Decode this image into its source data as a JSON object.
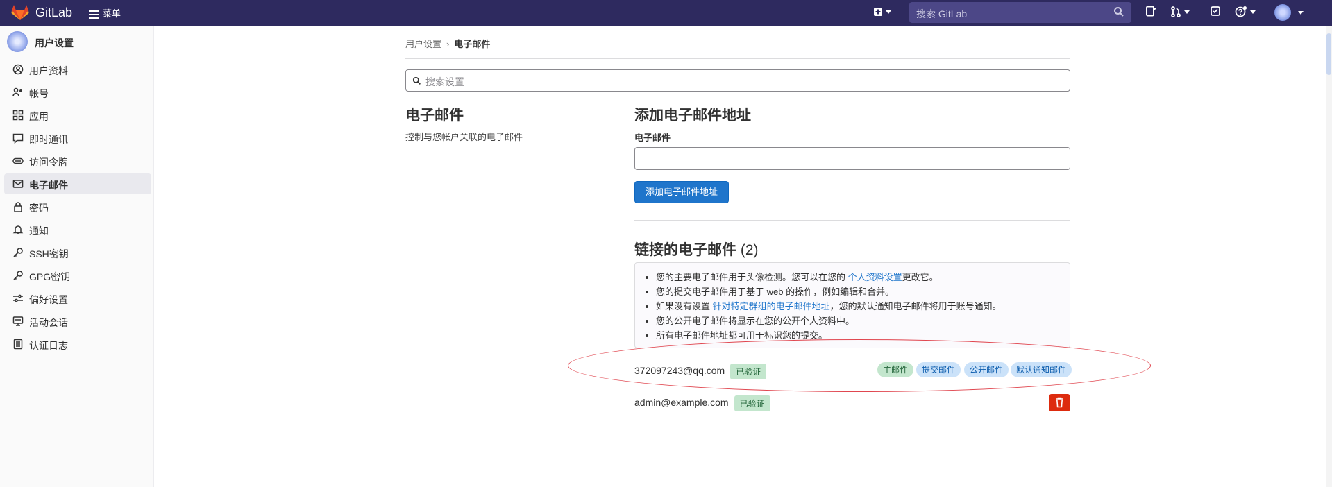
{
  "topbar": {
    "brand": "GitLab",
    "menu_label": "菜单",
    "search_placeholder": "搜索 GitLab",
    "icons": [
      "plus-square-icon",
      "issues-icon",
      "merge-request-icon",
      "todo-icon",
      "help-icon",
      "avatar"
    ]
  },
  "sidebar": {
    "title": "用户设置",
    "items": [
      {
        "label": "用户资料",
        "icon": "profile-icon",
        "active": false
      },
      {
        "label": "帐号",
        "icon": "account-icon",
        "active": false
      },
      {
        "label": "应用",
        "icon": "applications-icon",
        "active": false
      },
      {
        "label": "即时通讯",
        "icon": "chat-icon",
        "active": false
      },
      {
        "label": "访问令牌",
        "icon": "token-icon",
        "active": false
      },
      {
        "label": "电子邮件",
        "icon": "mail-icon",
        "active": true
      },
      {
        "label": "密码",
        "icon": "lock-icon",
        "active": false
      },
      {
        "label": "通知",
        "icon": "bell-icon",
        "active": false
      },
      {
        "label": "SSH密钥",
        "icon": "key-icon",
        "active": false
      },
      {
        "label": "GPG密钥",
        "icon": "key-icon",
        "active": false
      },
      {
        "label": "偏好设置",
        "icon": "preferences-icon",
        "active": false
      },
      {
        "label": "活动会话",
        "icon": "monitor-icon",
        "active": false
      },
      {
        "label": "认证日志",
        "icon": "log-icon",
        "active": false
      }
    ]
  },
  "breadcrumb": {
    "parent": "用户设置",
    "current": "电子邮件"
  },
  "settings_search": {
    "placeholder": "搜索设置"
  },
  "section": {
    "title": "电子邮件",
    "description": "控制与您帐户关联的电子邮件"
  },
  "add_email": {
    "title": "添加电子邮件地址",
    "field_label": "电子邮件",
    "field_value": "",
    "button": "添加电子邮件地址"
  },
  "linked": {
    "title": "链接的电子邮件",
    "count": "(2)",
    "info": [
      {
        "pre": "您的主要电子邮件用于头像检测。您可以在您的 ",
        "link": "个人资料设置",
        "post": "更改它。"
      },
      {
        "pre": "您的提交电子邮件用于基于 web 的操作，例如编辑和合并。",
        "link": "",
        "post": ""
      },
      {
        "pre": "如果没有设置 ",
        "link": "针对特定群组的电子邮件地址",
        "post": "，您的默认通知电子邮件将用于账号通知。"
      },
      {
        "pre": "您的公开电子邮件将显示在您的公开个人资料中。",
        "link": "",
        "post": ""
      },
      {
        "pre": "所有电子邮件地址都可用于标识您的提交。",
        "link": "",
        "post": ""
      }
    ],
    "emails": [
      {
        "address": "372097243@qq.com",
        "status": "已验证",
        "tags": [
          "主邮件",
          "提交邮件",
          "公开邮件",
          "默认通知邮件"
        ]
      },
      {
        "address": "admin@example.com",
        "status": "已验证",
        "tags": []
      }
    ]
  },
  "colors": {
    "navbar": "#2e2a5f",
    "primary_button": "#1f75cb",
    "danger_button": "#dd2b0e",
    "verified_badge": "#c3e6cd",
    "annotation": "#e0464f"
  }
}
